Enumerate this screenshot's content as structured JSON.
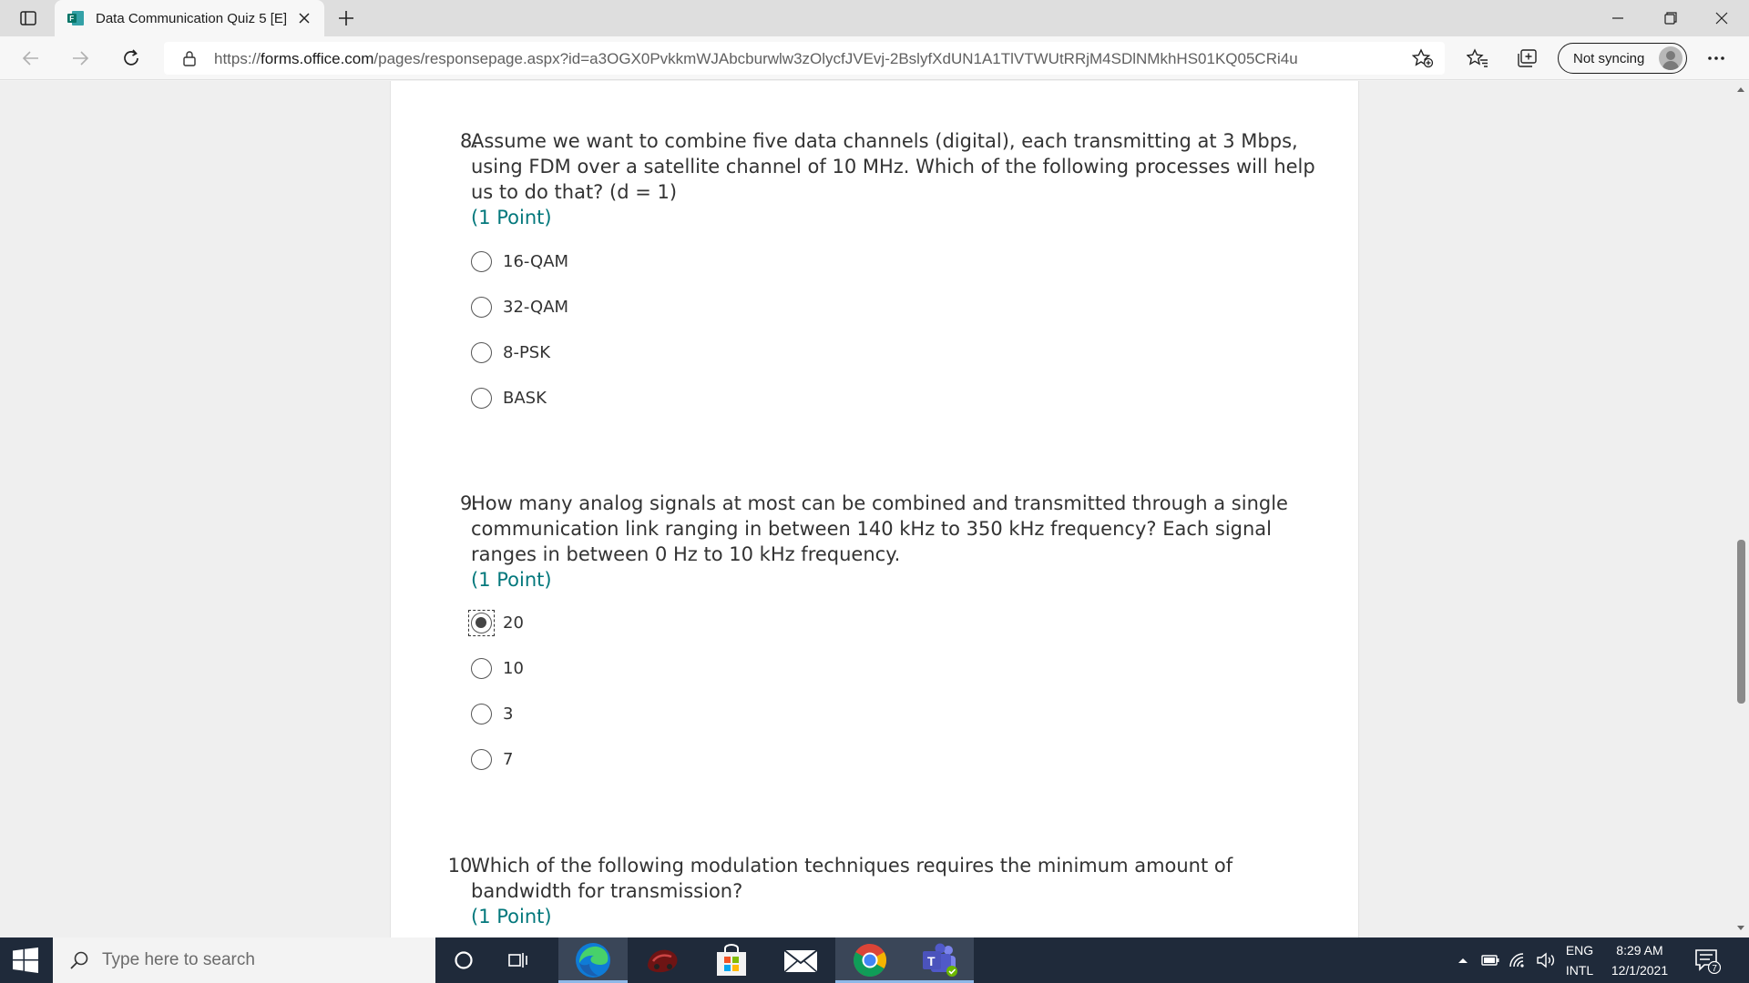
{
  "browser": {
    "tab_title": "Data Communication Quiz 5 [E] l",
    "url_prefix": "https://",
    "url_host": "forms.office.com",
    "url_path": "/pages/responsepage.aspx?id=a3OGX0PvkkmWJAbcburwlw3zOlycfJVEvj-2BslyfXdUN1A1TlVTWUtRRjM4SDlNMkhHS01KQ05CRi4u",
    "sync_label": "Not syncing"
  },
  "form": {
    "questions": [
      {
        "number": "8.",
        "text": "Assume we want to combine five data channels (digital), each transmitting at 3 Mbps, using FDM over a satellite channel of 10 MHz. Which of the following processes will help us to do that? (d = 1)",
        "points": "(1 Point)",
        "options": [
          "16-QAM",
          "32-QAM",
          "8-PSK",
          "BASK"
        ],
        "selected_index": -1
      },
      {
        "number": "9.",
        "text": "How many analog signals at most can be combined and transmitted through a single communication link ranging in between 140 kHz to 350 kHz frequency? Each signal ranges in between 0 Hz to 10 kHz frequency.",
        "points": "(1 Point)",
        "options": [
          "20",
          "10",
          "3",
          "7"
        ],
        "selected_index": 0
      },
      {
        "number": "10.",
        "text": "Which of the following modulation techniques requires the minimum amount of bandwidth for transmission?",
        "points": "(1 Point)",
        "options": [],
        "selected_index": -1
      }
    ]
  },
  "taskbar": {
    "search_placeholder": "Type here to search",
    "lang_top": "ENG",
    "lang_bottom": "INTL",
    "time": "8:29 AM",
    "date": "12/1/2021",
    "notification_count": "7"
  },
  "icons": {
    "tab_actions": "tab-actions-icon",
    "favicon": "forms-favicon-icon",
    "back": "back-arrow-icon",
    "forward": "forward-arrow-icon",
    "refresh": "refresh-icon",
    "lock": "lock-icon",
    "add_favorite": "add-favorite-icon",
    "favorites": "favorites-icon",
    "collections": "collections-icon",
    "more": "more-icon",
    "start": "windows-start-icon",
    "cortana": "cortana-icon",
    "task_view": "task-view-icon",
    "edge": "edge-icon",
    "chrome": "chrome-icon",
    "teams": "teams-icon"
  },
  "colors": {
    "accent_points": "#03787c",
    "taskbar": "#1f2a3a"
  }
}
